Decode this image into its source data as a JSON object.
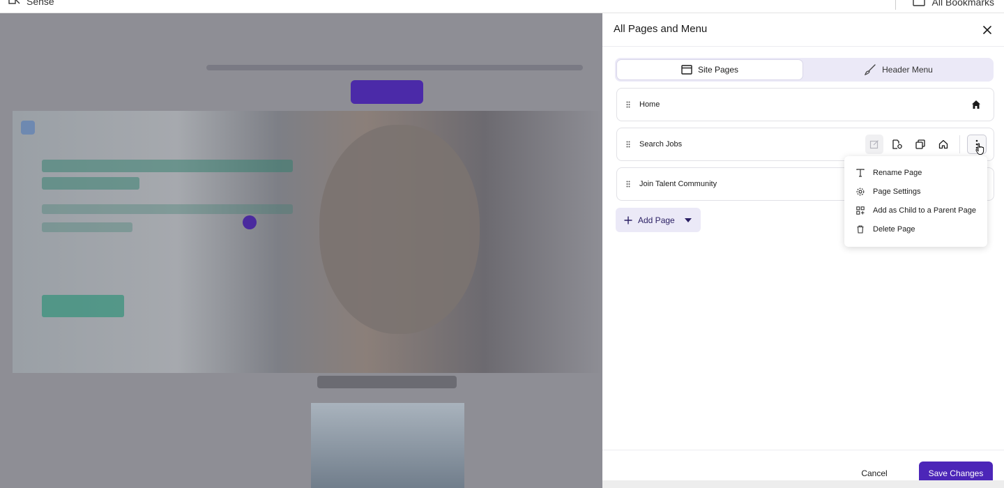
{
  "browser": {
    "app_label": "Sense",
    "bookmarks_label": "All Bookmarks"
  },
  "panel": {
    "title": "All Pages and Menu",
    "tabs": [
      {
        "label": "Site Pages",
        "icon": "browser-window-icon",
        "active": true
      },
      {
        "label": "Header Menu",
        "icon": "paint-brush-icon",
        "active": false
      }
    ],
    "pages": [
      {
        "name": "Home",
        "is_home": true
      },
      {
        "name": "Search Jobs",
        "is_home": false
      },
      {
        "name": "Join Talent Community",
        "is_home": false
      }
    ],
    "add_page_label": "Add Page",
    "context_menu": [
      {
        "label": "Rename Page",
        "icon": "text-cursor-icon"
      },
      {
        "label": "Page Settings",
        "icon": "gear-icon"
      },
      {
        "label": "Add as Child to a Parent Page",
        "icon": "hierarchy-icon"
      },
      {
        "label": "Delete Page",
        "icon": "trash-icon"
      }
    ],
    "cancel_label": "Cancel",
    "save_label": "Save Changes"
  },
  "colors": {
    "accent": "#4c26b8",
    "tab_bg": "#ebe9f7",
    "overlay": "#8e8e95"
  }
}
